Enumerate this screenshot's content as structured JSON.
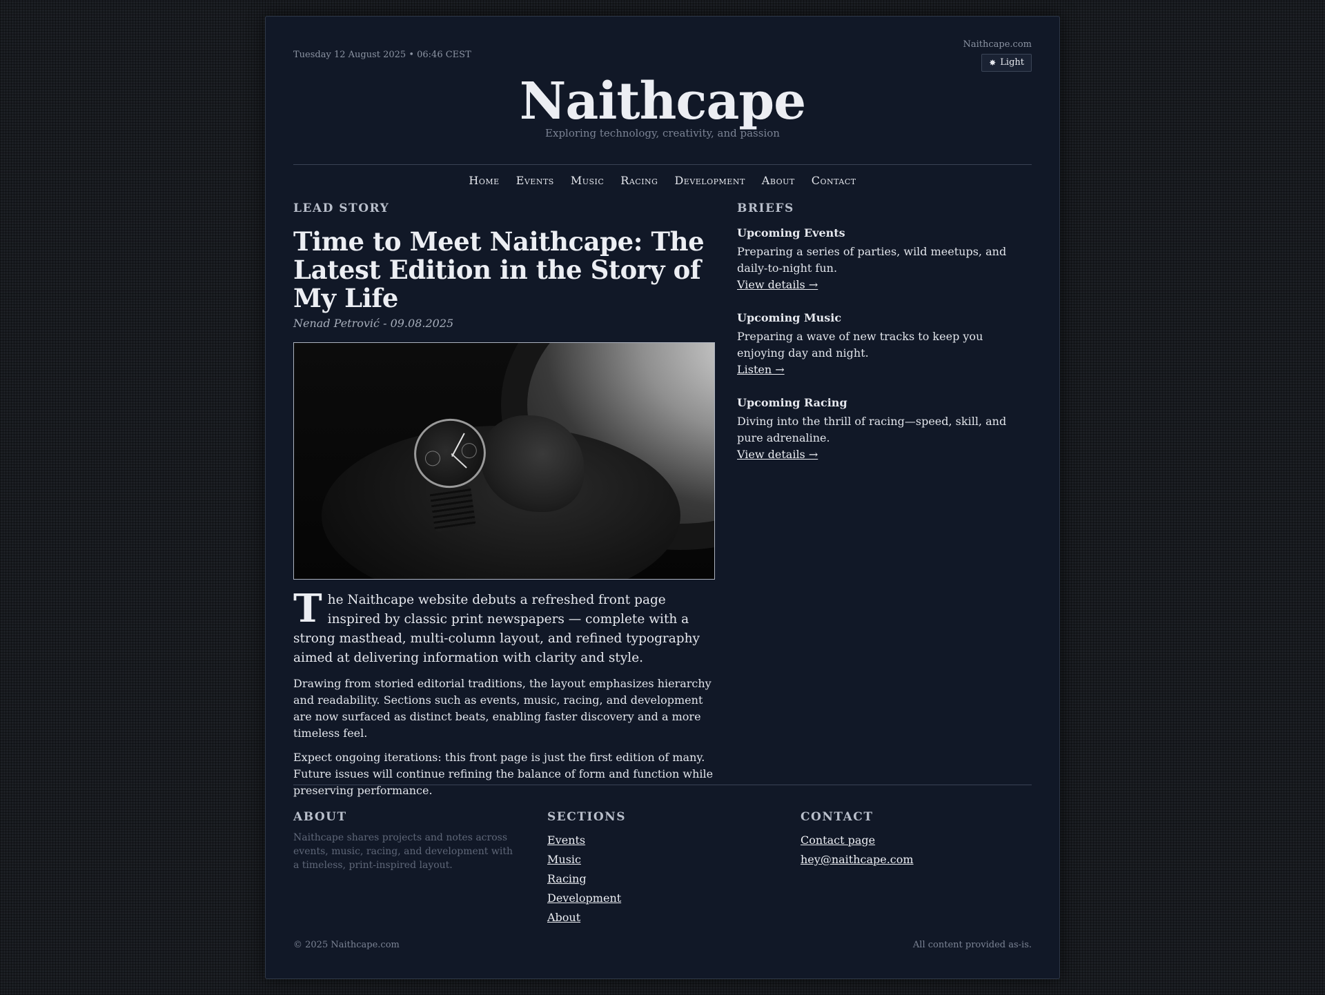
{
  "masthead": {
    "dateline": "Tuesday 12 August 2025 • 06:46 CEST",
    "site_link": "Naithcape.com",
    "theme_toggle_icon": "sun-icon",
    "theme_toggle_label": "Light",
    "title": "Naithcape",
    "tagline": "Exploring technology, creativity, and passion"
  },
  "nav": {
    "items": [
      {
        "label": "Home"
      },
      {
        "label": "Events"
      },
      {
        "label": "Music"
      },
      {
        "label": "Racing"
      },
      {
        "label": "Development"
      },
      {
        "label": "About"
      },
      {
        "label": "Contact"
      }
    ]
  },
  "lead": {
    "kicker": "LEAD STORY",
    "headline": "Time to Meet Naithcape: The Latest Edition in the Story of My Life",
    "byline": "Nenad Petrović - 09.08.2025",
    "image_alt": "Wristwatch on an arm next to an airplane window",
    "dropcap": "T",
    "first_paragraph_rest": "he Naithcape website debuts a refreshed front page inspired by classic print newspapers — complete with a strong masthead, multi-column layout, and refined typography aimed at delivering information with clarity and style.",
    "paragraph_2": "Drawing from storied editorial traditions, the layout emphasizes hierarchy and readability. Sections such as events, music, racing, and development are now surfaced as distinct beats, enabling faster discovery and a more timeless feel.",
    "paragraph_3": "Expect ongoing iterations: this front page is just the first edition of many. Future issues will continue refining the balance of form and function while preserving performance."
  },
  "briefs": {
    "heading": "BRIEFS",
    "items": [
      {
        "title": "Upcoming Events",
        "text": "Preparing a series of parties, wild meetups, and daily-to-night fun.",
        "link": "View details →"
      },
      {
        "title": "Upcoming Music",
        "text": "Preparing a wave of new tracks to keep you enjoying day and night.",
        "link": "Listen →"
      },
      {
        "title": "Upcoming Racing",
        "text": "Diving into the thrill of racing—speed, skill, and pure adrenaline.",
        "link": "View details →"
      }
    ]
  },
  "footer": {
    "about_heading": "ABOUT",
    "about_text": "Naithcape shares projects and notes across events, music, racing, and development with a timeless, print-inspired layout.",
    "sections_heading": "SECTIONS",
    "sections": [
      "Events",
      "Music",
      "Racing",
      "Development",
      "About"
    ],
    "contact_heading": "CONTACT",
    "contact_links": [
      "Contact page",
      "hey@naithcape.com"
    ],
    "copyright": "© 2025 Naithcape.com",
    "disclaimer": "All content provided as-is."
  }
}
